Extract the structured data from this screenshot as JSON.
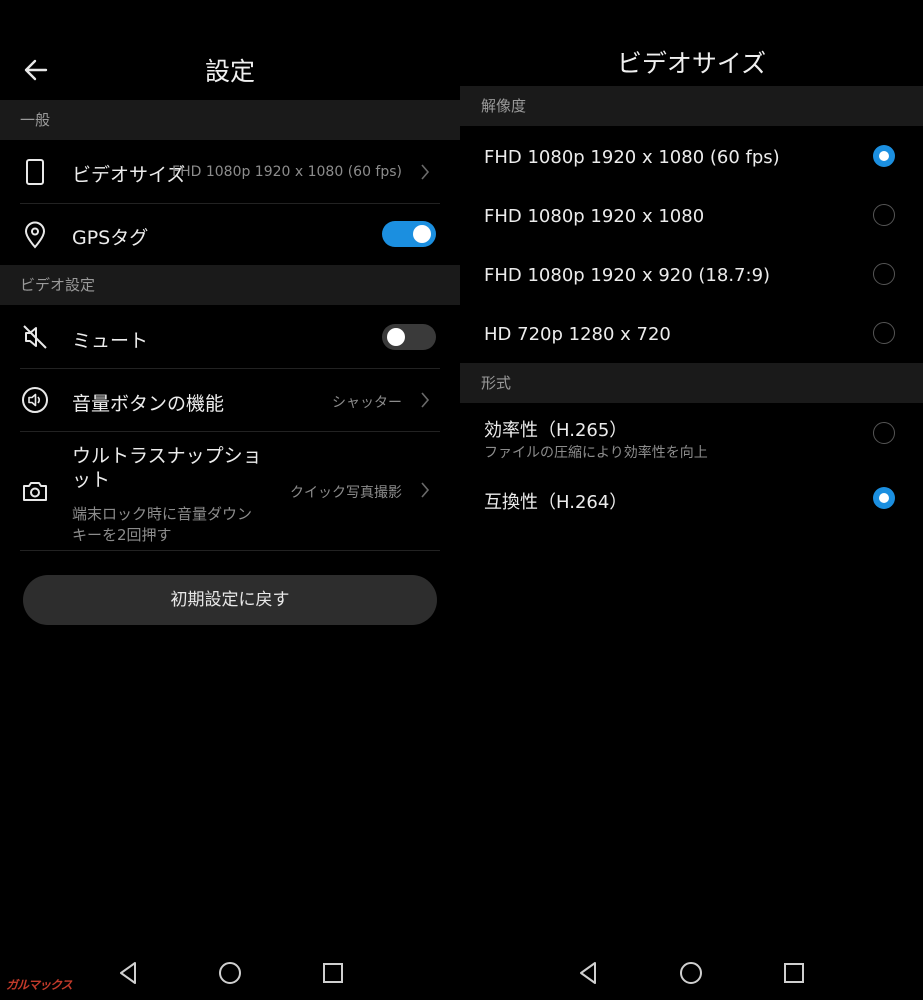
{
  "left": {
    "title": "設定",
    "sections": {
      "general": "一般",
      "video": "ビデオ設定"
    },
    "video_size": {
      "label": "ビデオサイズ",
      "value": "FHD 1080p 1920 x 1080 (60 fps)"
    },
    "gps": {
      "label": "GPSタグ",
      "state": "on"
    },
    "mute": {
      "label": "ミュート",
      "state": "off"
    },
    "volume_button": {
      "label": "音量ボタンの機能",
      "value": "シャッター"
    },
    "ultra_snapshot": {
      "label_line1": "ウルトラスナップショ",
      "label_line2": "ット",
      "value": "クイック写真撮影",
      "sub_line1": "端末ロック時に音量ダウン",
      "sub_line2": "キーを2回押す"
    },
    "reset_button": "初期設定に戻す"
  },
  "right": {
    "title": "ビデオサイズ",
    "sections": {
      "resolution": "解像度",
      "format": "形式"
    },
    "resolutions": [
      {
        "label": "FHD 1080p 1920 x 1080 (60 fps)",
        "selected": true
      },
      {
        "label": "FHD 1080p 1920 x 1080",
        "selected": false
      },
      {
        "label": "FHD 1080p 1920 x 920 (18.7:9)",
        "selected": false
      },
      {
        "label": "HD 720p 1280 x 720",
        "selected": false
      }
    ],
    "formats": [
      {
        "label": "効率性（H.265）",
        "sub": "ファイルの圧縮により効率性を向上",
        "selected": false
      },
      {
        "label": "互換性（H.264）",
        "sub": "",
        "selected": true
      }
    ]
  },
  "watermark": "ガルマックス",
  "colors": {
    "accent": "#1b8fe0",
    "background": "#000000",
    "section_bg": "#1a1a1a"
  }
}
